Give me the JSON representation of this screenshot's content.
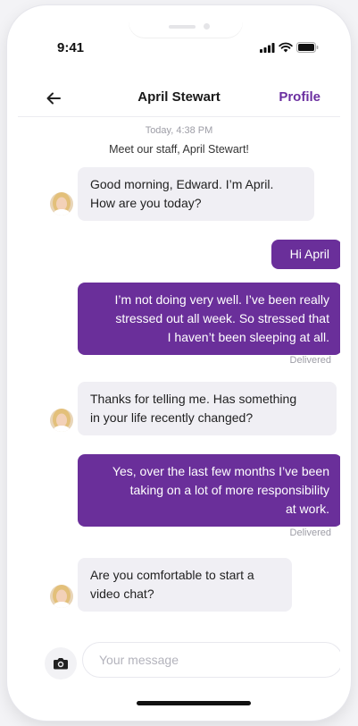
{
  "status_bar": {
    "time": "9:41"
  },
  "header": {
    "title": "April Stewart",
    "profile_label": "Profile"
  },
  "conversation": {
    "timestamp": "Today, 4:38 PM",
    "intro": "Meet our staff, April Stewart!",
    "messages": [
      {
        "direction": "in",
        "lines": [
          "Good morning, Edward. I’m April.",
          "How are you today?"
        ]
      },
      {
        "direction": "out",
        "lines": [
          "Hi April"
        ]
      },
      {
        "direction": "out",
        "lines": [
          "I’m not doing very well. I’ve been really",
          "stressed out all week. So stressed that",
          "I haven’t been sleeping at all."
        ],
        "status": "Delivered"
      },
      {
        "direction": "in",
        "lines": [
          "Thanks for telling me. Has something",
          "in your life recently changed?"
        ]
      },
      {
        "direction": "out",
        "lines": [
          "Yes, over the last few months I’ve been",
          "taking on a lot of more responsibility",
          "at work."
        ],
        "status": "Delivered"
      },
      {
        "direction": "in",
        "lines": [
          "Are you comfortable to start a",
          "video chat?"
        ]
      }
    ]
  },
  "composer": {
    "placeholder": "Your message",
    "value": ""
  },
  "colors": {
    "accent": "#6a2f9a",
    "incoming_bubble": "#f0eff4",
    "meta_text": "#9d9da6"
  },
  "icons": [
    "back-arrow-icon",
    "signal-icon",
    "wifi-icon",
    "battery-icon",
    "camera-icon",
    "avatar"
  ]
}
